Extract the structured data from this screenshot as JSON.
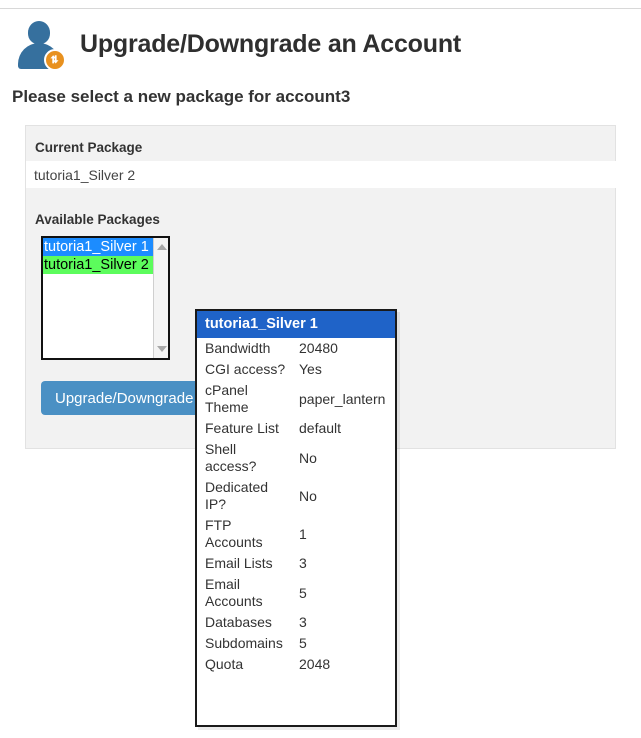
{
  "header": {
    "title": "Upgrade/Downgrade an Account",
    "icon": "user-upgrade-icon",
    "subtitle": "Please select a new package for account3"
  },
  "panel": {
    "current_package_label": "Current Package",
    "current_package_value": "tutoria1_Silver 2",
    "available_packages_label": "Available Packages",
    "available_packages": [
      {
        "label": "tutoria1_Silver 1",
        "state": "selected-blue"
      },
      {
        "label": "tutoria1_Silver 2",
        "state": "highlighted-green"
      }
    ],
    "submit_button_label": "Upgrade/Downgrade",
    "magnifier_icon": "magnifying-glass-icon"
  },
  "popup": {
    "title": "tutoria1_Silver 1",
    "rows": [
      {
        "key": "Bandwidth",
        "value": "20480"
      },
      {
        "key": "CGI access?",
        "value": "Yes"
      },
      {
        "key": "cPanel Theme",
        "value": "paper_lantern"
      },
      {
        "key": "Feature List",
        "value": "default"
      },
      {
        "key": "Shell access?",
        "value": "No"
      },
      {
        "key": "Dedicated IP?",
        "value": "No"
      },
      {
        "key": "FTP Accounts",
        "value": "1"
      },
      {
        "key": "Email Lists",
        "value": "3"
      },
      {
        "key": "Email Accounts",
        "value": "5"
      },
      {
        "key": "Databases",
        "value": "3"
      },
      {
        "key": "Subdomains",
        "value": "5"
      },
      {
        "key": "Quota",
        "value": "2048"
      }
    ]
  },
  "colors": {
    "accent_blue": "#4a90c4",
    "popup_header_blue": "#1f63c8",
    "selection_blue": "#1c8cff",
    "highlight_green": "#5cfc5c",
    "highlight_box_orange": "#e8481c",
    "icon_blue": "#36709e",
    "icon_badge_orange": "#e8911f"
  }
}
